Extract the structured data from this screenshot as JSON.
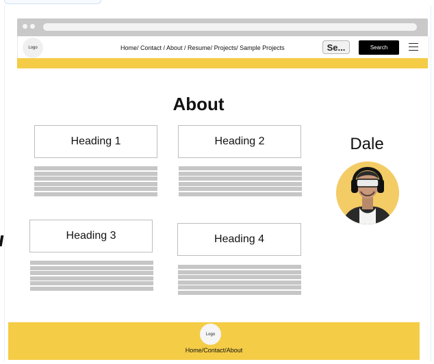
{
  "navbar": {
    "logo_text": "Logo",
    "links": "Home/ Contact / About / Resume/ Projects/ Sample Projects",
    "search_input_value": "Se...",
    "search_button_label": "Search",
    "menu_icon": "hamburger-menu-icon"
  },
  "main": {
    "title": "About",
    "sections": [
      {
        "heading": "Heading 1"
      },
      {
        "heading": "Heading 2"
      },
      {
        "heading": "Heading 3"
      },
      {
        "heading": "Heading 4"
      }
    ],
    "profile": {
      "name": "Dale",
      "avatar_icon": "person-avatar"
    }
  },
  "footer": {
    "logo_text": "Logo",
    "links": "Home/Contact/About"
  },
  "colors": {
    "accent_yellow": "#f4cc46",
    "button_black": "#000000",
    "placeholder_gray": "#c6c6c6"
  }
}
